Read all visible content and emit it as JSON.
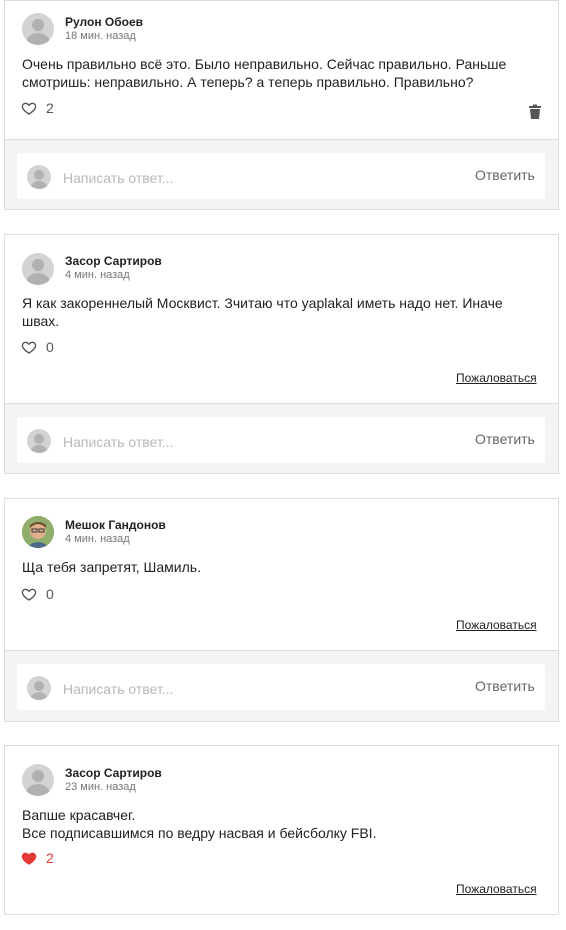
{
  "comments": [
    {
      "author": "Рулон Обоев",
      "time": "18 мин. назад",
      "lines": [
        "Очень правильно всё это. Было неправильно. Сейчас правильно. Раньше",
        "смотришь: неправильно. А теперь? а теперь правильно. Правильно?"
      ],
      "likes": "2"
    },
    {
      "author": "Засор Сартиров",
      "time": "4 мин. назад",
      "lines": [
        "Я как закореннелый Москвист. Зчитаю что yaplakal иметь надо нет. Иначе",
        "швах."
      ],
      "likes": "0",
      "complain": "Пожаловаться"
    },
    {
      "author": "Мешок Гандонов",
      "time": "4 мин. назад",
      "lines": [
        "Ща тебя запретят, Шамиль."
      ],
      "likes": "0",
      "complain": "Пожаловаться"
    },
    {
      "author": "Засор Сартиров",
      "time": "23 мин. назад",
      "lines": [
        "Вапше красавчег.",
        "Все подписавшимся по ведру насвая и бейсболку FBI."
      ],
      "likes": "2",
      "complain": "Пожаловаться"
    }
  ],
  "reply": {
    "placeholder": "Написать ответ...",
    "button": "Ответить"
  },
  "colors": {
    "liked_heart": "#e53935",
    "reply_zone_bg": "#f4f4f6"
  }
}
